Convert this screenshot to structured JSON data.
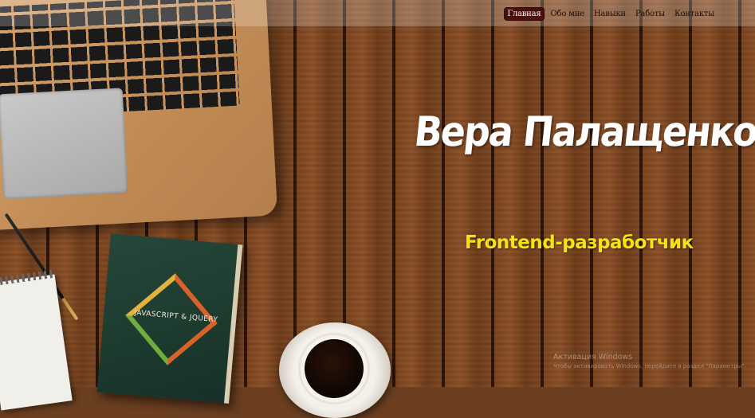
{
  "nav": {
    "items": [
      "Главная",
      "Обо мне",
      "Навыки",
      "Работы",
      "Контакты"
    ],
    "active_index": 0
  },
  "hero": {
    "name": "Вера Палащенко",
    "role": "Frontend-разработчик"
  },
  "decor": {
    "book_title": "JAVASCRIPT & JQUERY"
  },
  "watermark": {
    "title": "Активация Windows",
    "subtitle": "Чтобы активировать Windows, перейдите в раздел \"Параметры\"."
  },
  "colors": {
    "nav_active_bg": "#4a0f0a",
    "name_color": "#ffffff",
    "role_color": "#f4e313"
  }
}
